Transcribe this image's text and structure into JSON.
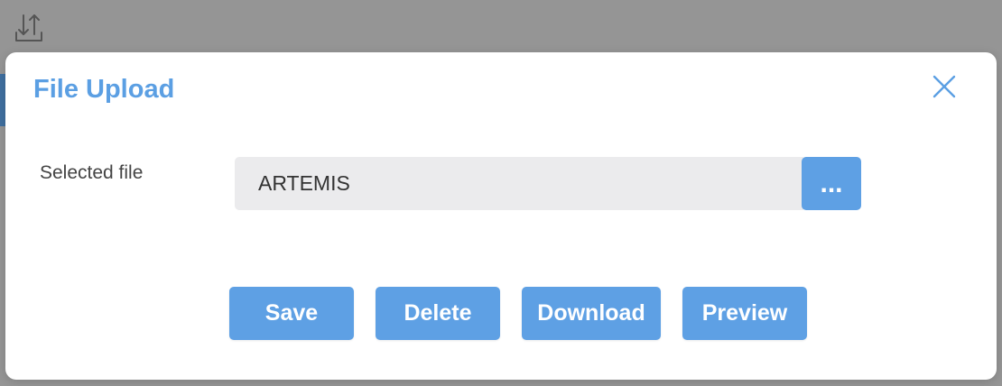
{
  "background": {
    "icon": "upload-icon"
  },
  "modal": {
    "title": "File Upload",
    "close_icon": "close-icon",
    "selected_file": {
      "label": "Selected file",
      "value": "ARTEMIS",
      "browse_label": "..."
    },
    "actions": {
      "save": "Save",
      "delete": "Delete",
      "download": "Download",
      "preview": "Preview"
    }
  },
  "colors": {
    "accent": "#5ea0e4",
    "title": "#5b9fe3",
    "overlay": "#959595",
    "input_bg": "#ebebed"
  }
}
